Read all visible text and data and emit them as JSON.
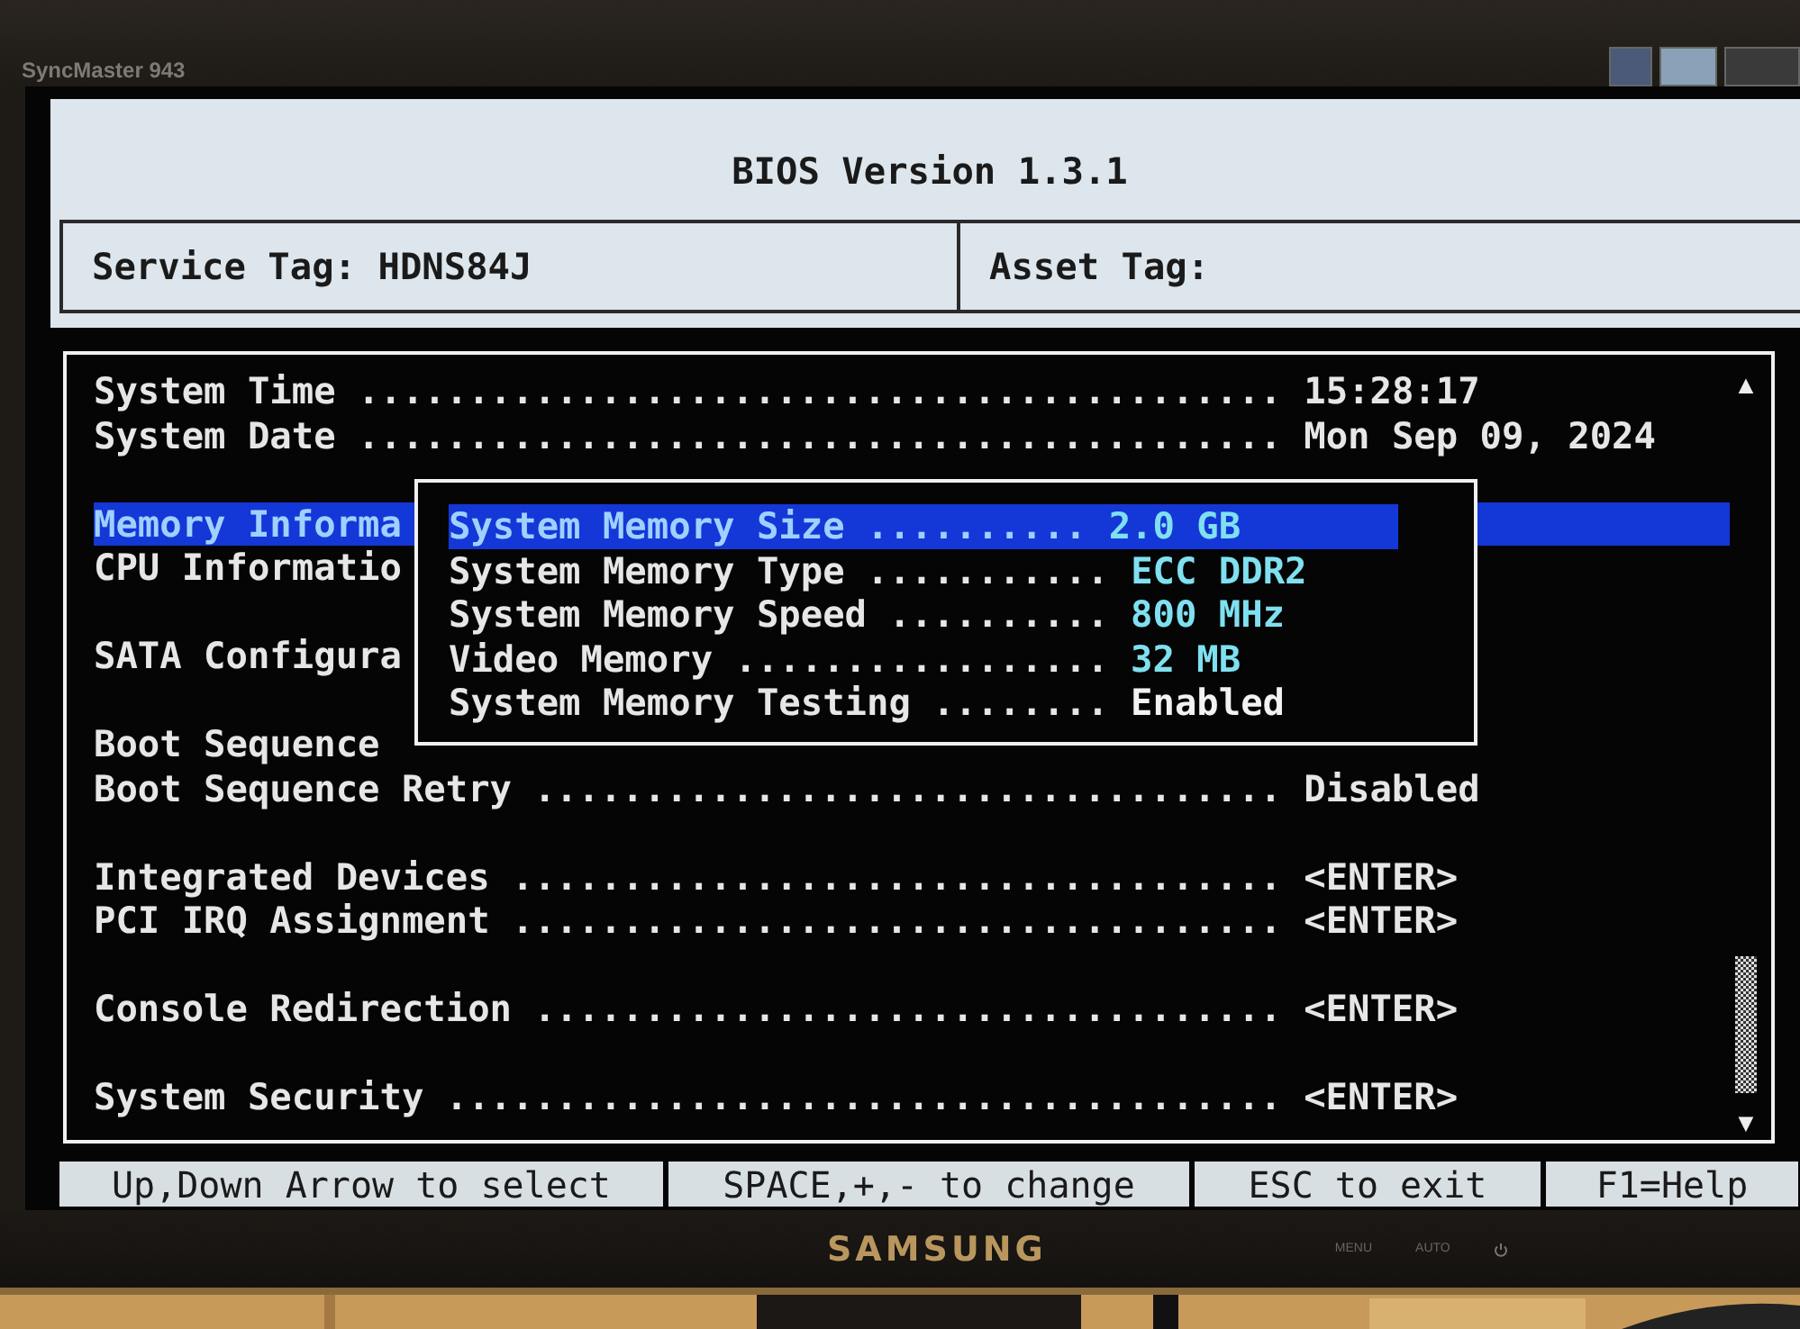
{
  "monitor": {
    "model": "SyncMaster 943",
    "brand": "SAMSUNG",
    "buttons": [
      "MENU",
      "AUTO"
    ]
  },
  "header": {
    "title": "BIOS Version 1.3.1",
    "service_tag": "Service Tag: HDNS84J",
    "asset_tag": "Asset Tag:"
  },
  "menu": {
    "groups": [
      {
        "items": [
          {
            "label": "System Time",
            "dots": "..........................................",
            "value": "15:28:17",
            "selected": false
          },
          {
            "label": "System Date",
            "dots": "..........................................",
            "value": "Mon Sep 09, 2024",
            "selected": false
          }
        ]
      },
      {
        "items": [
          {
            "label": "Memory Informa",
            "selected": true
          },
          {
            "label": "CPU Informatio",
            "selected": false
          }
        ]
      },
      {
        "items": [
          {
            "label": "SATA Configura",
            "selected": false
          }
        ]
      },
      {
        "items": [
          {
            "label": "Boot Sequence",
            "selected": false
          },
          {
            "label": "Boot Sequence Retry",
            "dots": "..................................",
            "value": "Disabled",
            "selected": false
          }
        ]
      },
      {
        "items": [
          {
            "label": "Integrated Devices",
            "dots": "...................................",
            "value": "<ENTER>",
            "selected": false
          },
          {
            "label": "PCI IRQ Assignment",
            "dots": "...................................",
            "value": "<ENTER>",
            "selected": false
          }
        ]
      },
      {
        "items": [
          {
            "label": "Console Redirection",
            "dots": "..................................",
            "value": "<ENTER>",
            "selected": false
          }
        ]
      },
      {
        "items": [
          {
            "label": "System Security",
            "dots": "......................................",
            "value": "<ENTER>",
            "selected": false
          }
        ]
      }
    ]
  },
  "scrollbar": {
    "up": "▲",
    "down": "▼"
  },
  "popup": {
    "items": [
      {
        "label": "System Memory Size",
        "dots": "..........",
        "value": "2.0 GB",
        "kind": "info",
        "selected": true
      },
      {
        "label": "System Memory Type",
        "dots": "...........",
        "value": "ECC DDR2",
        "kind": "info",
        "selected": false
      },
      {
        "label": "System Memory Speed",
        "dots": "..........",
        "value": "800 MHz",
        "kind": "info",
        "selected": false
      },
      {
        "label": "Video Memory",
        "dots": ".................",
        "value": "32 MB",
        "kind": "info",
        "selected": false
      },
      {
        "label": "System Memory Testing",
        "dots": "........",
        "value": "Enabled",
        "kind": "setting",
        "selected": false
      }
    ]
  },
  "footer": [
    "Up,Down Arrow to select",
    "SPACE,+,- to change",
    "ESC to exit",
    "F1=Help"
  ]
}
